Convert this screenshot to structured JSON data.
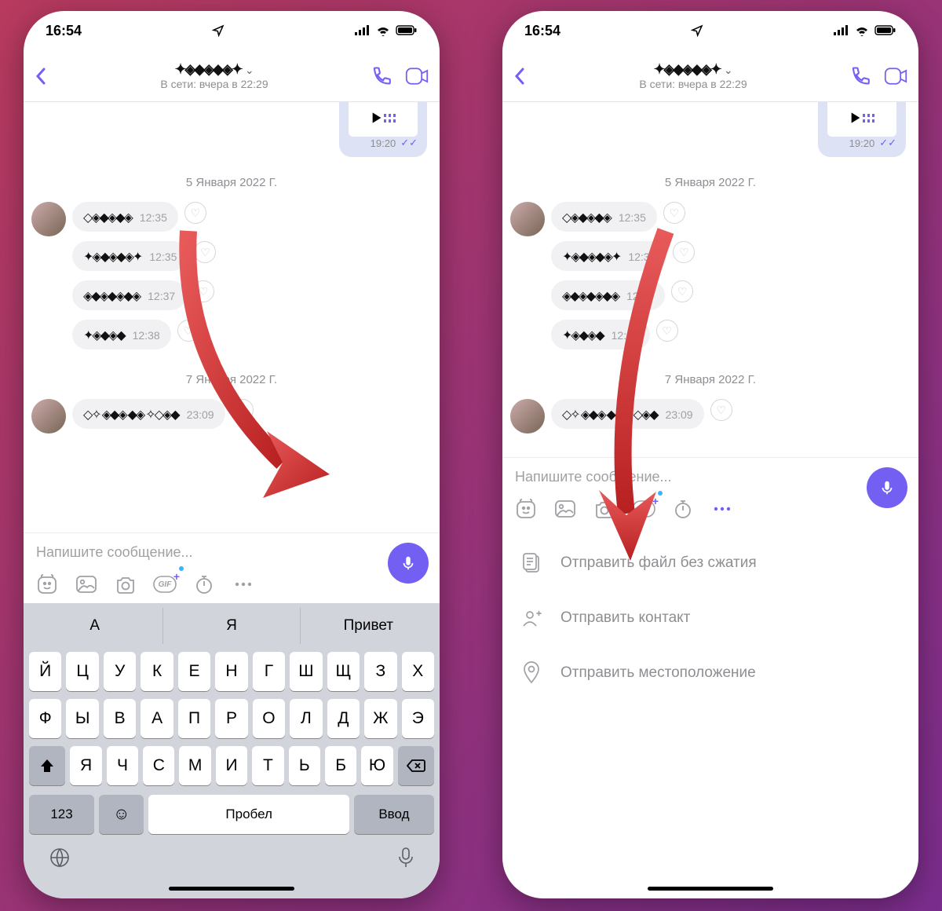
{
  "statusbar": {
    "time": "16:54"
  },
  "header": {
    "last_seen": "В сети: вчера в 22:29"
  },
  "outgoing": {
    "time": "19:20"
  },
  "date1": "5 Января 2022 Г.",
  "date2": "7 Января 2022 Г.",
  "incoming": [
    {
      "time": "12:35"
    },
    {
      "time": "12:35"
    },
    {
      "time": "12:37"
    },
    {
      "time": "12:38"
    }
  ],
  "incoming2": [
    {
      "time": "23:09"
    }
  ],
  "composer": {
    "placeholder": "Напишите сообщение..."
  },
  "keyboard": {
    "suggestions": [
      "А",
      "Я",
      "Привет"
    ],
    "row1": [
      "Й",
      "Ц",
      "У",
      "К",
      "Е",
      "Н",
      "Г",
      "Ш",
      "Щ",
      "З",
      "Х"
    ],
    "row2": [
      "Ф",
      "Ы",
      "В",
      "А",
      "П",
      "Р",
      "О",
      "Л",
      "Д",
      "Ж",
      "Э"
    ],
    "row3": [
      "Я",
      "Ч",
      "С",
      "М",
      "И",
      "Т",
      "Ь",
      "Б",
      "Ю"
    ],
    "num_key": "123",
    "space_key": "Пробел",
    "enter_key": "Ввод"
  },
  "menu": {
    "send_file": "Отправить файл без сжатия",
    "send_contact": "Отправить контакт",
    "send_location": "Отправить местоположение"
  }
}
